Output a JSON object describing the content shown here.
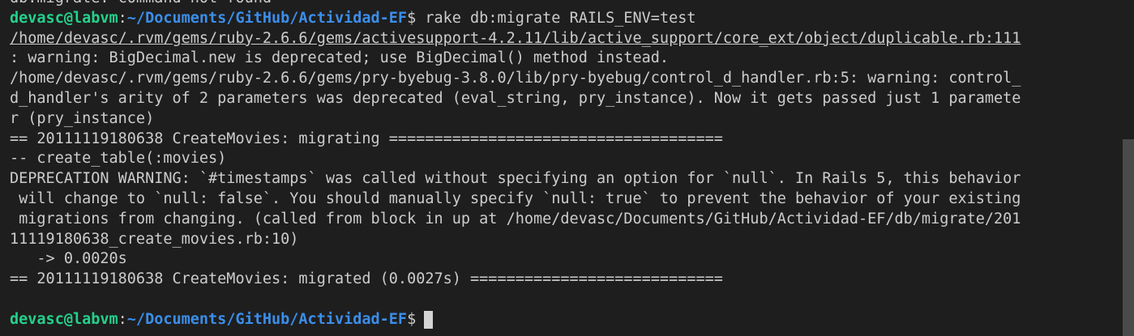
{
  "terminal": {
    "line0": "db:migrate: command not found",
    "prompt": {
      "user_host": "devasc@labvm",
      "sep": ":",
      "path": "~/Documents/GitHub/Actividad-EF",
      "symbol": "$",
      "command": " rake db:migrate RAILS_ENV=test"
    },
    "warn_path": "/home/devasc/.rvm/gems/ruby-2.6.6/gems/activesupport-4.2.11/lib/active_support/core_ext/object/duplicable.rb:111",
    "line3": ": warning: BigDecimal.new is deprecated; use BigDecimal() method instead.",
    "line4": "/home/devasc/.rvm/gems/ruby-2.6.6/gems/pry-byebug-3.8.0/lib/pry-byebug/control_d_handler.rb:5: warning: control_",
    "line5": "d_handler's arity of 2 parameters was deprecated (eval_string, pry_instance). Now it gets passed just 1 paramete",
    "line6": "r (pry_instance)",
    "line7": "== 20111119180638 CreateMovies: migrating =====================================",
    "line8": "-- create_table(:movies)",
    "line9": "DEPRECATION WARNING: `#timestamps` was called without specifying an option for `null`. In Rails 5, this behavior",
    "line10": " will change to `null: false`. You should manually specify `null: true` to prevent the behavior of your existing",
    "line11": " migrations from changing. (called from block in up at /home/devasc/Documents/GitHub/Actividad-EF/db/migrate/201",
    "line12": "11119180638_create_movies.rb:10)",
    "line13": "   -> 0.0020s",
    "line14": "== 20111119180638 CreateMovies: migrated (0.0027s) ============================",
    "line15": "",
    "prompt2": {
      "user_host": "devasc@labvm",
      "sep": ":",
      "path": "~/Documents/GitHub/Actividad-EF",
      "symbol": "$"
    }
  },
  "colors": {
    "background": "#1e1e1e",
    "text": "#cccccc",
    "prompt_user": "#23d18b",
    "prompt_path": "#3b8eea"
  }
}
